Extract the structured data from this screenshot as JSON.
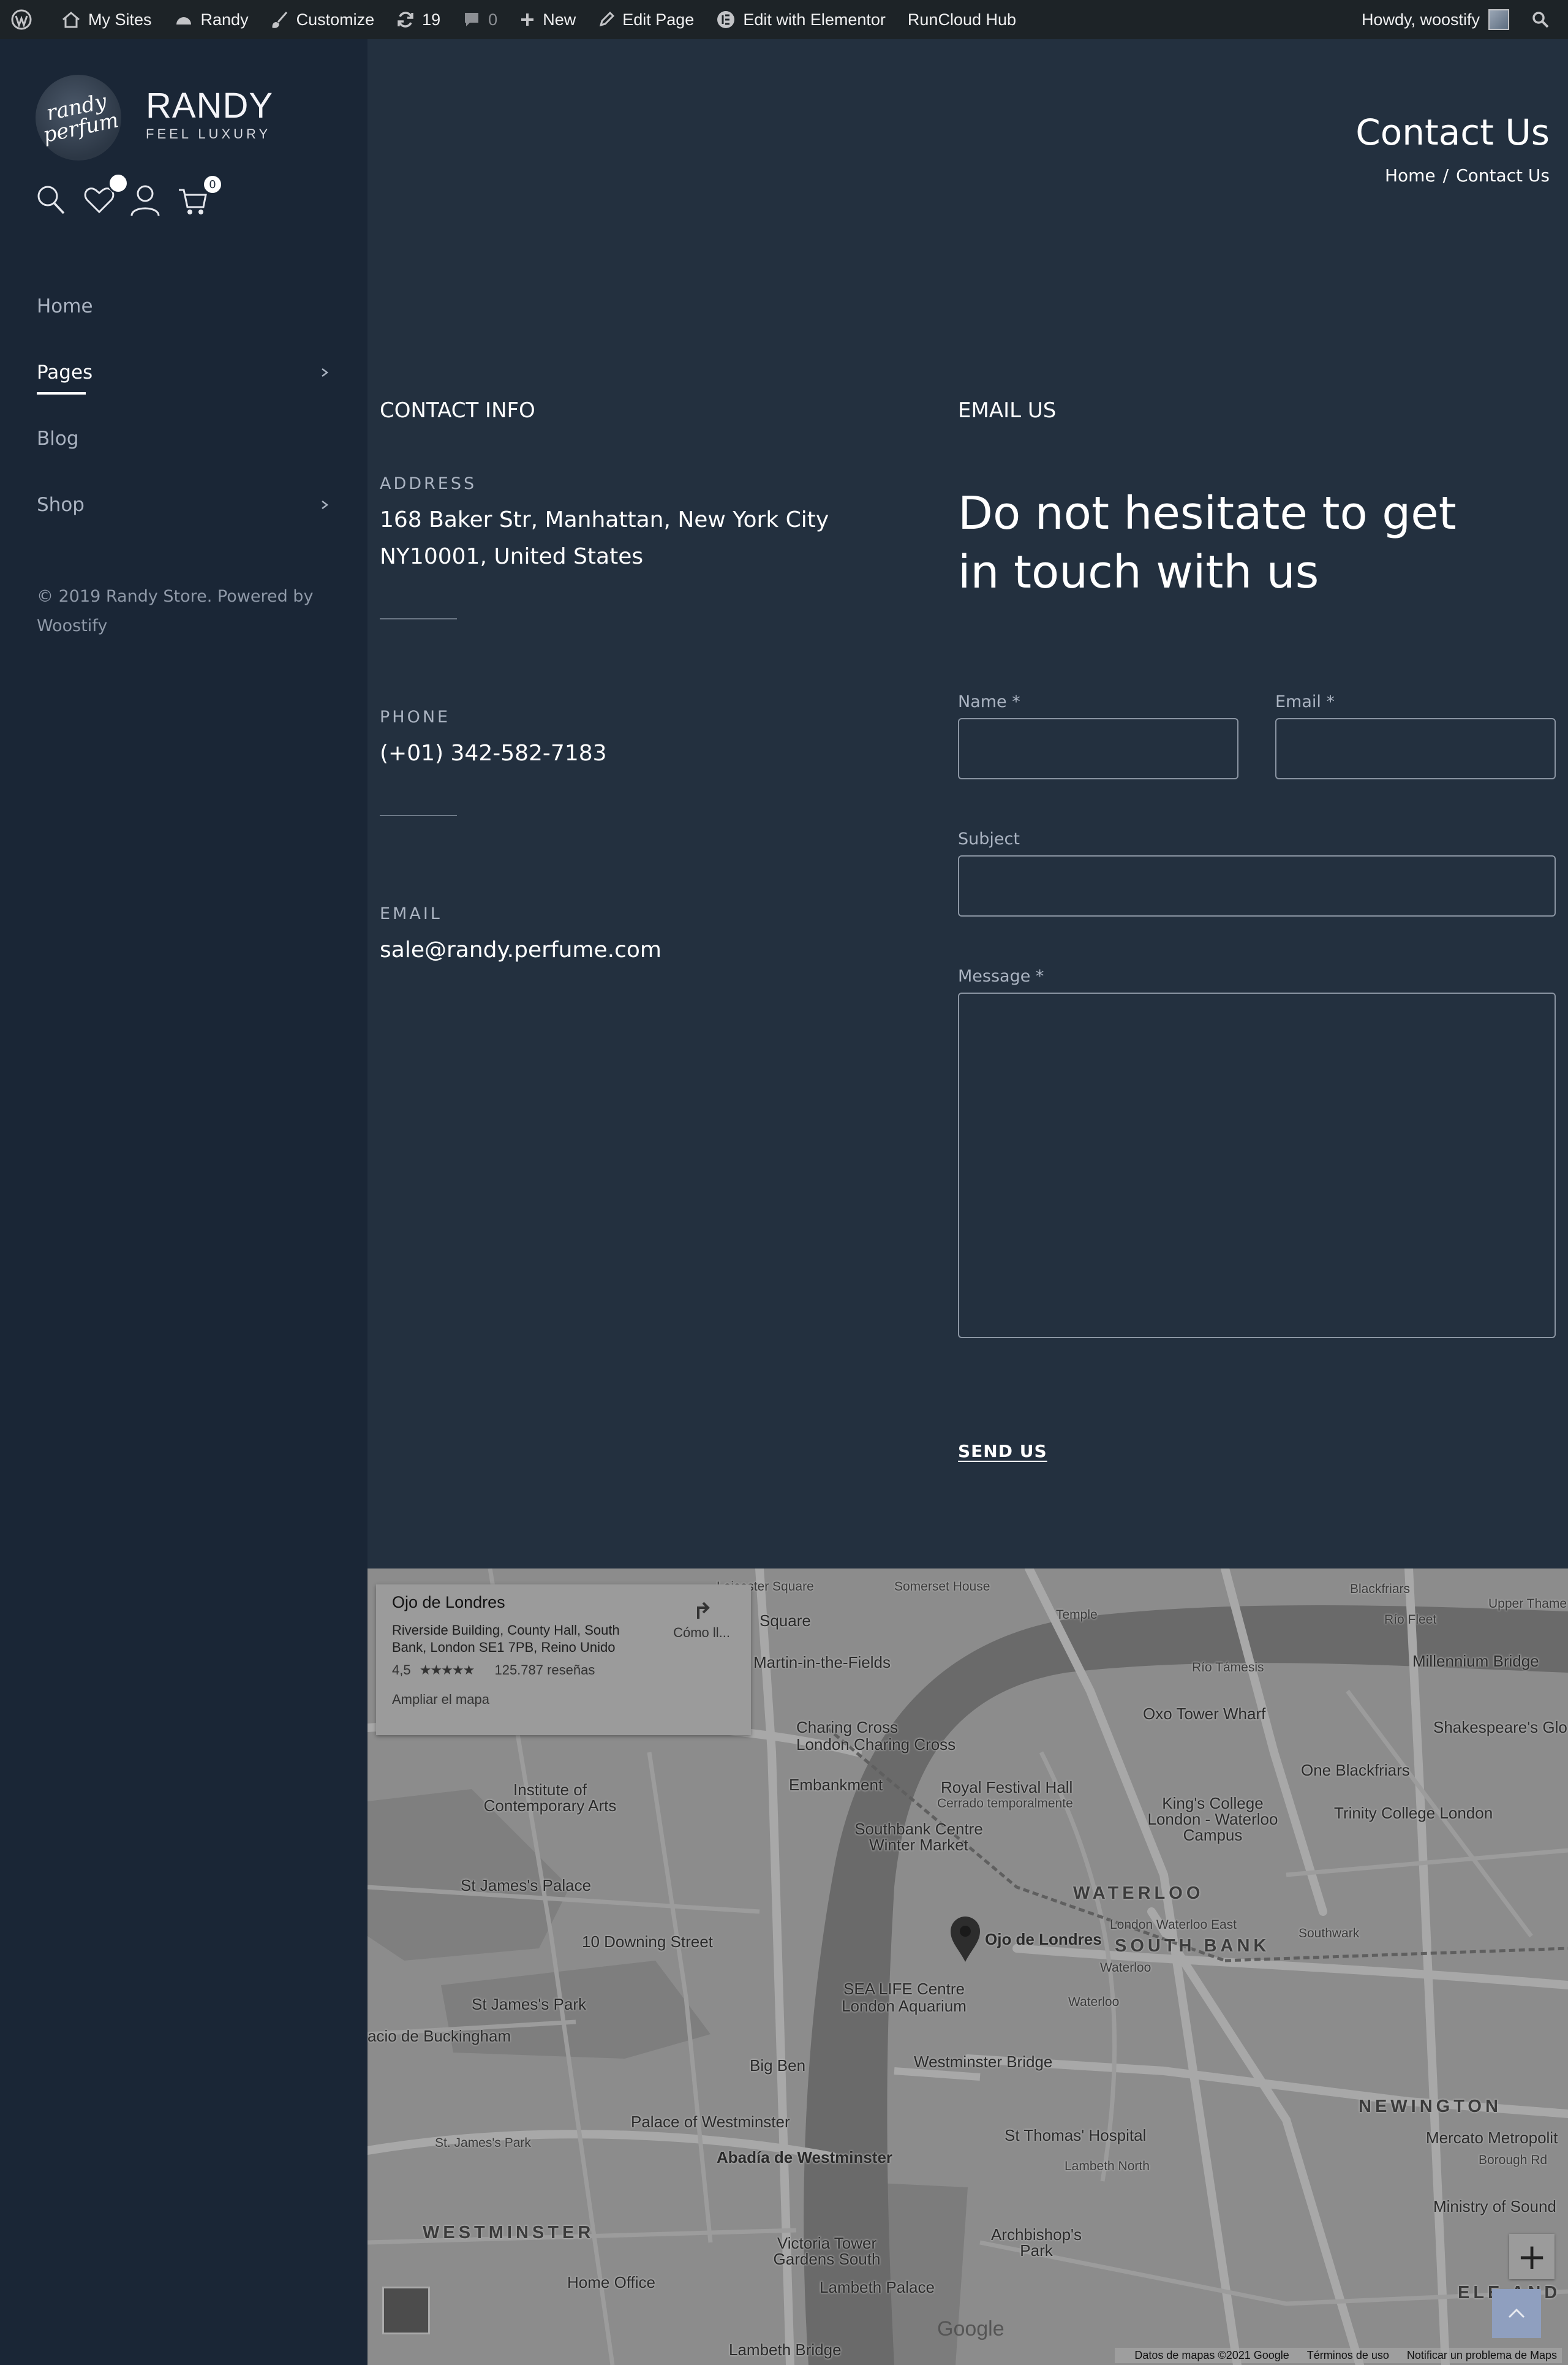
{
  "adminbar": {
    "items": [
      {
        "label": "My Sites"
      },
      {
        "label": "Randy"
      },
      {
        "label": "Customize"
      },
      {
        "label": "19"
      },
      {
        "label": "0"
      },
      {
        "label": "New"
      },
      {
        "label": "Edit Page"
      },
      {
        "label": "Edit with Elementor"
      },
      {
        "label": "RunCloud Hub"
      }
    ],
    "greeting": "Howdy, woostify"
  },
  "brand": {
    "logo_line1": "randy",
    "logo_line2": "perfum",
    "name": "RANDY",
    "tagline": "FEEL LUXURY"
  },
  "header": {
    "wishlist_count": "",
    "cart_count": "0"
  },
  "nav": {
    "items": [
      {
        "label": "Home"
      },
      {
        "label": "Pages"
      },
      {
        "label": "Blog"
      },
      {
        "label": "Shop"
      }
    ]
  },
  "footer": {
    "copyright": "© 2019 Randy Store. Powered by Woostify"
  },
  "page": {
    "title": "Contact Us",
    "breadcrumb_home": "Home",
    "breadcrumb_sep": "/",
    "breadcrumb_current": "Contact Us"
  },
  "contact_info": {
    "heading": "CONTACT INFO",
    "address_label": "ADDRESS",
    "address_line1": "168 Baker Str, Manhattan, New York City",
    "address_line2": "NY10001, United States",
    "phone_label": "PHONE",
    "phone": "(+01) 342-582-7183",
    "email_label": "EMAIL",
    "email": "sale@randy.perfume.com"
  },
  "email_form": {
    "heading": "EMAIL US",
    "title": "Do not hesitate to get in touch with us",
    "name_label": "Name *",
    "email_label": "Email *",
    "subject_label": "Subject",
    "message_label": "Message *",
    "submit": "SEND US"
  },
  "map": {
    "card": {
      "title": "Ojo de Londres",
      "address": "Riverside Building, County Hall, South Bank, London SE1 7PB, Reino Unido",
      "rating": "4,5",
      "stars": "★★★★★",
      "reviews": "125.787 reseñas",
      "directions": "Cómo ll...",
      "enlarge": "Ampliar el mapa"
    },
    "labels": {
      "leicester": "Leicester Square",
      "somerset": "Somerset House",
      "temple": "Temple",
      "blackfriars": "Blackfriars",
      "riofleet": "Río Fleet",
      "upperthames": "Upper Thame",
      "square": "Square",
      "stmartin": "Martin-in-the-Fields",
      "riotamesis": "Río Támesis",
      "millennium": "Millennium Bridge",
      "oxo": "Oxo Tower Wharf",
      "shakespeare": "Shakespeare's Glo",
      "charingcross": "Charing Cross",
      "londoncharing": "London Charing Cross",
      "embankment": "Embankment",
      "royalfestival": "Royal Festival Hall",
      "cerrado": "Cerrado temporalmente",
      "oneblackfriars": "One Blackfriars",
      "institute": "Institute of Contemporary Arts",
      "kingscollege": "King's College London - Waterloo Campus",
      "trinity": "Trinity College London",
      "southbankcentre": "Southbank Centre Winter Market",
      "stjamespalace": "St James's Palace",
      "waterloo_area": "WATERLOO",
      "downing": "10 Downing Street",
      "ojo": "Ojo de Londres",
      "londonwaterlooeast": "London Waterloo East",
      "southwark": "Southwark",
      "southbank_area": "SOUTH BANK",
      "waterloo": "Waterloo",
      "waterloo2": "Waterloo",
      "stjamespark": "St James's Park",
      "sealife": "SEA LIFE Centre London Aquarium",
      "buckingham": "acio de Buckingham",
      "bigben": "Big Ben",
      "westminsterbridge": "Westminster Bridge",
      "newington_area": "NEWINGTON",
      "mercato": "Mercato Metropolit",
      "palacewestminster": "Palace of Westminster",
      "stjamesparkstn": "St. James's Park",
      "abadia": "Abadía de Westminster",
      "stthomas": "St Thomas' Hospital",
      "lambethnorth": "Lambeth North",
      "boroughrd": "Borough Rd",
      "ministry": "Ministry of Sound",
      "westminster_area": "WESTMINSTER",
      "victoriatower": "Victoria Tower Gardens South",
      "archbishop": "Archbishop's Park",
      "homeoffice": "Home Office",
      "lambethpalace": "Lambeth Palace",
      "lambethbridge": "Lambeth Bridge",
      "elephant_area": "ELE AND"
    },
    "zoom_in": "+",
    "google": "Google",
    "footer_data": "Datos de mapas ©2021 Google",
    "footer_terms": "Términos de uso",
    "footer_report": "Notificar un problema de Maps"
  },
  "colors": {
    "sidebar_bg": "#1a2636",
    "main_bg": "#23303f",
    "adminbar_bg": "#1d2327",
    "map_bg": "#8a8a8a"
  }
}
